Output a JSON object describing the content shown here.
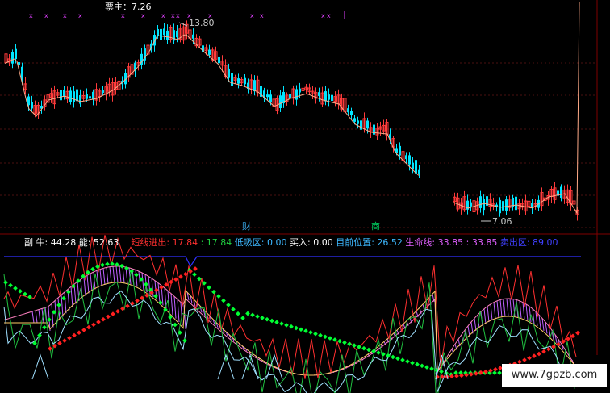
{
  "main_pane": {
    "title": "票主：7.26",
    "price_high": "13.80",
    "price_low": "7.06",
    "marker_cai": "财",
    "marker_shang": "商"
  },
  "indicator_bar": {
    "fu": "副",
    "niu": "牛: 44.28",
    "neng": "能: 52.63",
    "duanxian_label": "短线进出: 17.84",
    "duanxian_value": ": 17.84",
    "dixi_label": "低吸区: 0.00",
    "mairu_label": "买入: 0.00",
    "mubiao_label": "目前位置: 26.52",
    "shengming_label": "生命线: 33.85",
    "shengming_value": ": 33.85",
    "maichu_label": "卖出区: 89.00"
  },
  "colors": {
    "up_candle": "#ff3b3b",
    "down_candle": "#00e5ff",
    "bar_purple": "#c060ff",
    "green_dots": "#00ff33",
    "red_dots": "#ff2020",
    "line_white": "#e8e8ff",
    "line_red": "#ff3030",
    "line_green": "#20c040",
    "line_yellow": "#ffcc66",
    "line_blue": "#3030ff"
  },
  "watermark": "www.7gpzb.com"
}
